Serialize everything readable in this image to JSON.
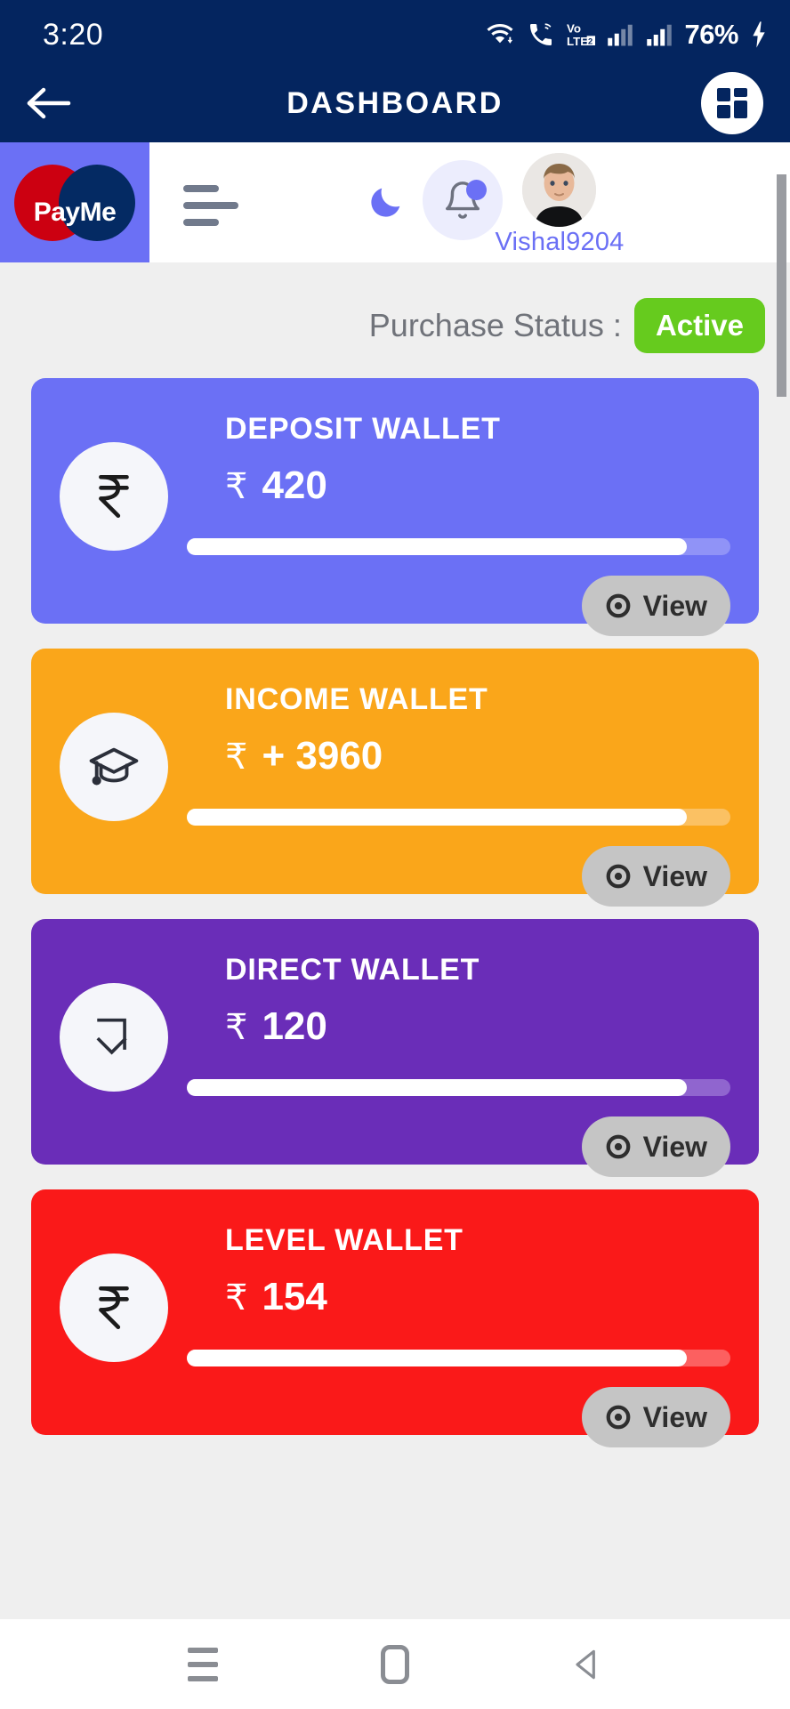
{
  "status_bar": {
    "time": "3:20",
    "battery": "76%",
    "icons": [
      "wifi-icon",
      "call-wifi-icon",
      "volte-icon",
      "signal-bars-1-icon",
      "signal-bars-2-icon",
      "charging-bolt-icon"
    ]
  },
  "app_bar": {
    "title": "DASHBOARD",
    "back_icon": "back-arrow-icon",
    "grid_icon": "dashboard-grid-icon",
    "background": "#04255F"
  },
  "web_header": {
    "logo_text": "PayMe",
    "logo_bg": "#6B70F5",
    "logo_red": "#CC0011",
    "logo_navy": "#042A63",
    "menu_icon": "hamburger-menu-icon",
    "dark_mode_icon": "moon-icon",
    "notifications_icon": "bell-icon",
    "avatar_icon": "user-avatar",
    "username": "Vishal9204",
    "username_color": "#6B70F5"
  },
  "purchase_status": {
    "label": "Purchase Status :",
    "value": "Active",
    "badge_color": "#66CB1E"
  },
  "wallets": [
    {
      "title": "DEPOSIT WALLET",
      "currency": "₹",
      "amount": "420",
      "icon": "rupee-icon",
      "color": "#6B70F5",
      "track_color": "#9093F7",
      "progress": 92,
      "view_label": "View"
    },
    {
      "title": "INCOME WALLET",
      "currency": "₹",
      "amount": "+ 3960",
      "icon": "graduation-cap-icon",
      "color": "#FAA61A",
      "track_color": "#FBC163",
      "progress": 92,
      "view_label": "View"
    },
    {
      "title": "DIRECT WALLET",
      "currency": "₹",
      "amount": "120",
      "icon": "down-arrow-icon",
      "color": "#6A2DB8",
      "track_color": "#9065CF",
      "progress": 92,
      "view_label": "View"
    },
    {
      "title": "LEVEL WALLET",
      "currency": "₹",
      "amount": "154",
      "icon": "rupee-icon",
      "color": "#FA1919",
      "track_color": "#FC6060",
      "progress": 92,
      "view_label": "View"
    }
  ],
  "android_nav": {
    "recent_label": "recent-apps",
    "home_label": "home",
    "back_label": "back"
  }
}
